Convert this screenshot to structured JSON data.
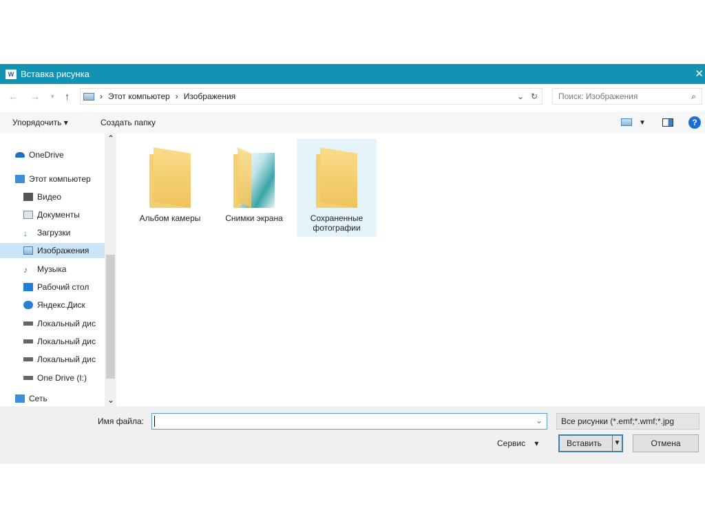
{
  "title": "Вставка рисунка",
  "app_icon": "W",
  "breadcrumb": [
    "Этот компьютер",
    "Изображения"
  ],
  "search_placeholder": "Поиск: Изображения",
  "toolbar": {
    "organize": "Упорядочить",
    "new_folder": "Создать папку"
  },
  "sidebar": [
    "OneDrive",
    "Этот компьютер",
    "Видео",
    "Документы",
    "Загрузки",
    "Изображения",
    "Музыка",
    "Рабочий стол",
    "Яндекс.Диск",
    "Локальный дис",
    "Локальный дис",
    "Локальный дис",
    "One Drive (I:)",
    "Сеть"
  ],
  "files": [
    {
      "name": "Альбом камеры"
    },
    {
      "name": "Снимки экрана"
    },
    {
      "name": "Сохраненные фотографии"
    }
  ],
  "bottom": {
    "filename_label": "Имя файла:",
    "filename_value": "",
    "filetype": "Все рисунки (*.emf;*.wmf;*.jpg",
    "tools": "Сервис",
    "insert": "Вставить",
    "cancel": "Отмена"
  },
  "colors": {
    "titlebar": "#1393b4",
    "selection": "#cce4f7"
  }
}
